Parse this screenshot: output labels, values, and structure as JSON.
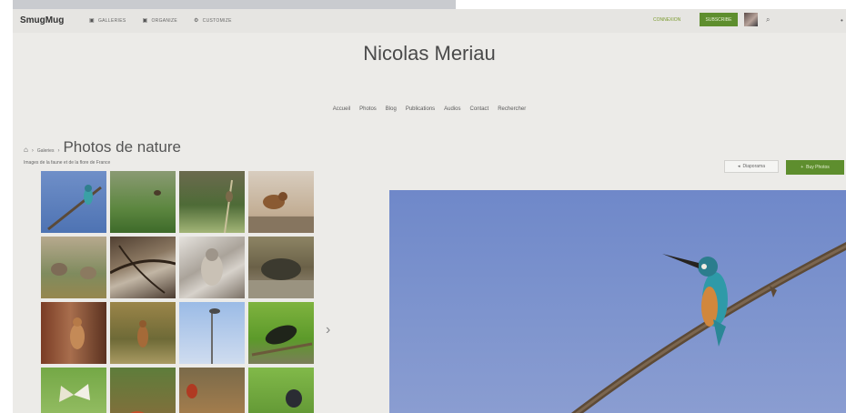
{
  "topbar": {
    "logo": "SmugMug",
    "nav": [
      {
        "icon": "image-icon",
        "glyph": "▣",
        "label": "Galleries"
      },
      {
        "icon": "image-icon",
        "glyph": "▣",
        "label": "Organize"
      },
      {
        "icon": "gear-icon",
        "glyph": "⚙",
        "label": "Customize"
      }
    ],
    "login_label": "Connexion",
    "subscribe_label": "Subscribe",
    "search_icon_glyph": "⌕",
    "dot_glyph": "•"
  },
  "site": {
    "title": "Nicolas Meriau",
    "nav": [
      "Accueil",
      "Photos",
      "Blog",
      "Publications",
      "Audios",
      "Contact",
      "Rechercher"
    ]
  },
  "breadcrumb": {
    "home_glyph": "⌂",
    "sep1": "›",
    "galleries": "Galeries",
    "sep2": "›",
    "title": "Photos de nature",
    "subtitle": "Images de la faune et de la flore de France"
  },
  "actions": {
    "prev_glyph": "◂",
    "prev_label": "Diaporama",
    "buy_glyph": "+",
    "buy_label": "Buy Photos"
  },
  "gallery": {
    "next_glyph": "›",
    "thumbnails": [
      {
        "name": "thumb-kingfisher"
      },
      {
        "name": "thumb-grass-bird"
      },
      {
        "name": "thumb-reed-bird"
      },
      {
        "name": "thumb-thrush"
      },
      {
        "name": "thumb-partridges"
      },
      {
        "name": "thumb-branches"
      },
      {
        "name": "thumb-snowy-owl"
      },
      {
        "name": "thumb-tortoise"
      },
      {
        "name": "thumb-squirrel"
      },
      {
        "name": "thumb-deer"
      },
      {
        "name": "thumb-pole-bird"
      },
      {
        "name": "thumb-beetle"
      },
      {
        "name": "thumb-butterfly"
      },
      {
        "name": "thumb-ladybird"
      },
      {
        "name": "thumb-dragonfly"
      },
      {
        "name": "thumb-dung-beetle"
      }
    ]
  },
  "main_photo": {
    "name": "kingfisher-photo"
  },
  "colors": {
    "accent": "#5e8e2e",
    "background": "#ecebe8",
    "photo_sky": "#7b92cd"
  }
}
